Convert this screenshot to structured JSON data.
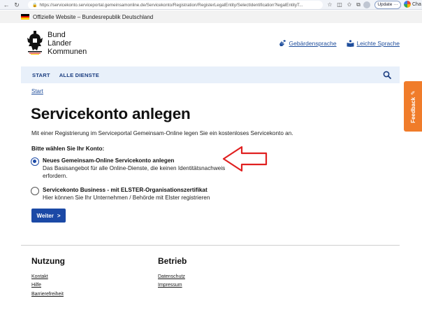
{
  "browser": {
    "url": "https://servicekonto.serviceportal.gemeinsamonline.de/Servicekonto/Registration/RegisterLegalEntity/SelectIdentification?legalEntityT...",
    "update_label": "Update",
    "update_more": "···",
    "cha_label": "Cha"
  },
  "official": {
    "text": "Offizielle Website – Bundesrepublik Deutschland"
  },
  "logo": {
    "line1": "Bund",
    "line2": "Länder",
    "line3": "Kommunen"
  },
  "header": {
    "links": [
      {
        "label": "Gebärdensprache"
      },
      {
        "label": "Leichte Sprache"
      }
    ]
  },
  "nav": {
    "items": [
      {
        "label": "START"
      },
      {
        "label": "ALLE DIENSTE"
      }
    ]
  },
  "breadcrumb": {
    "label": "Start"
  },
  "main": {
    "title": "Servicekonto anlegen",
    "intro": "Mit einer Registrierung im Serviceportal Gemeinsam-Online legen Sie ein kostenloses Servicekonto an.",
    "choose_label": "Bitte wählen Sie Ihr Konto:",
    "options": [
      {
        "title": "Neues Gemeinsam-Online Servicekonto anlegen",
        "desc_line1": "Das Basisangebot für alle Online-Dienste, die keinen Identitätsnachweis",
        "desc_line2": "erfordern.",
        "selected": true
      },
      {
        "title": "Servicekonto Business - mit ELSTER-Organisationszertifikat",
        "desc_line1": "Hier können Sie Ihr Unternehmen / Behörde mit Elster registrieren",
        "selected": false
      }
    ],
    "submit_label": "Weiter",
    "submit_chevron": ">"
  },
  "feedback": {
    "label": "Feedback"
  },
  "footer": {
    "columns": [
      {
        "heading": "Nutzung",
        "links": [
          "Kontakt",
          "Hilfe",
          "Barrierefreiheit"
        ]
      },
      {
        "heading": "Betrieb",
        "links": [
          "Datenschutz",
          "Impressum"
        ]
      }
    ]
  },
  "colors": {
    "primary": "#1b49a6",
    "nav_bg": "#e8f0fa",
    "feedback": "#f07c2a",
    "annotation": "#e02020"
  },
  "icons": {
    "back": "arrow-left-icon",
    "refresh": "refresh-icon",
    "search": "search-icon",
    "sign_language": "sign-language-icon",
    "easy_language": "easy-language-icon",
    "feedback": "pencil-icon"
  }
}
